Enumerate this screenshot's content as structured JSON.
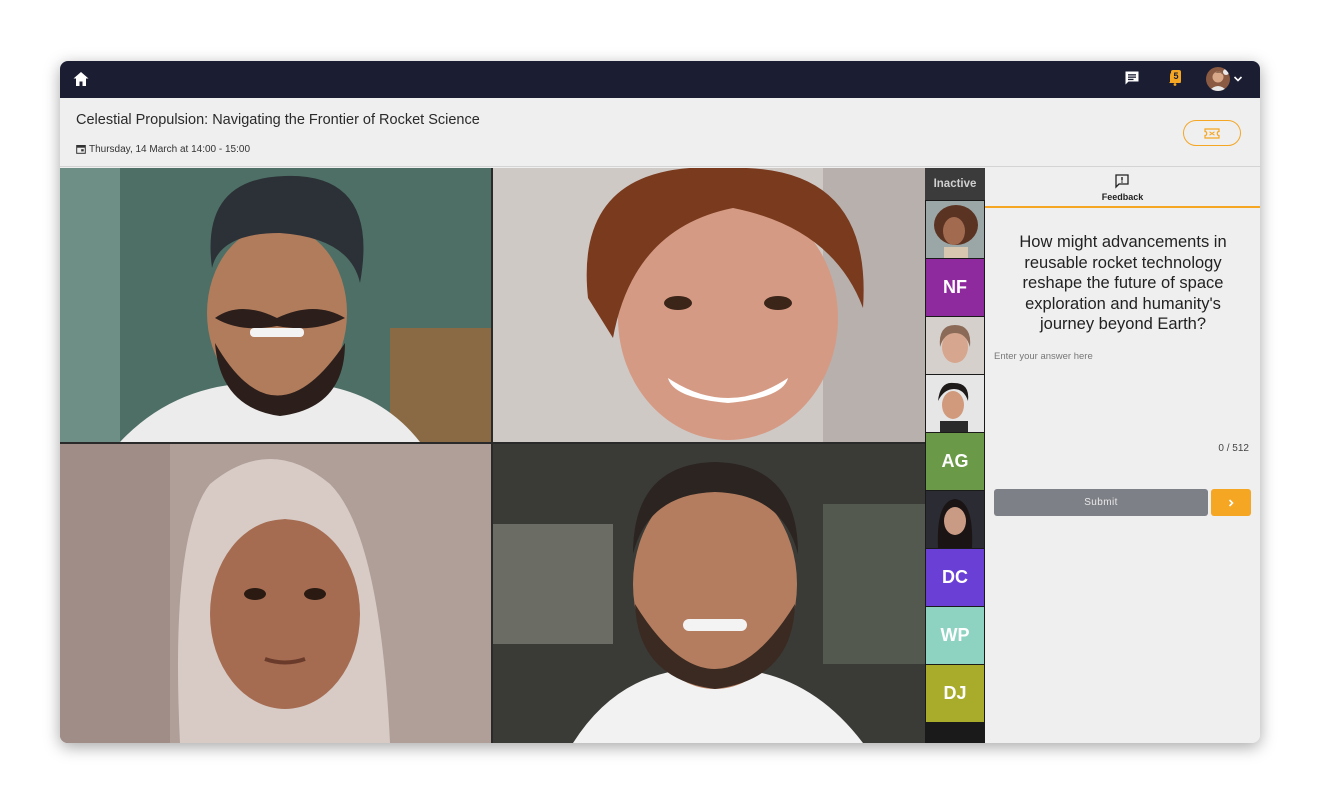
{
  "topbar": {
    "notification_count": "5",
    "icons": [
      "home-icon",
      "chat-icon",
      "bell-icon",
      "chevron-down-icon"
    ]
  },
  "event": {
    "title": "Celestial Propulsion: Navigating the Frontier of Rocket Science",
    "date": "Thursday, 14 March at 14:00 - 15:00"
  },
  "strip": {
    "header": "Inactive",
    "participants": [
      {
        "type": "photo"
      },
      {
        "type": "initials",
        "initials": "NF",
        "color": "#8e2a9e"
      },
      {
        "type": "photo"
      },
      {
        "type": "photo"
      },
      {
        "type": "initials",
        "initials": "AG",
        "color": "#6a9a48"
      },
      {
        "type": "photo"
      },
      {
        "type": "initials",
        "initials": "DC",
        "color": "#6a3fd6"
      },
      {
        "type": "initials",
        "initials": "WP",
        "color": "#8ed3c2"
      },
      {
        "type": "initials",
        "initials": "DJ",
        "color": "#a8ac2a"
      }
    ]
  },
  "feedback": {
    "tab_label": "Feedback",
    "question": "How might advancements in reusable rocket technology reshape the future of space exploration and humanity's journey beyond Earth?",
    "placeholder": "Enter your answer here",
    "counter": "0 / 512",
    "submit_label": "Submit"
  },
  "colors": {
    "topbar": "#1b1d33",
    "accent": "#f5a623",
    "panel_bg": "#efefef",
    "submit_bg": "#7e8087"
  }
}
